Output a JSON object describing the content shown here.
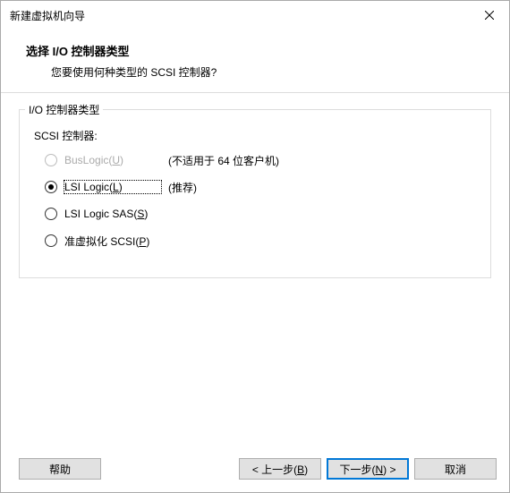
{
  "titlebar": {
    "title": "新建虚拟机向导"
  },
  "header": {
    "title": "选择 I/O 控制器类型",
    "subtitle": "您要使用何种类型的 SCSI 控制器?"
  },
  "group": {
    "legend": "I/O 控制器类型",
    "scsi_label": "SCSI 控制器:",
    "options": [
      {
        "label_pre": "BusLogic(",
        "mnemonic": "U",
        "label_post": ")",
        "note": "(不适用于 64 位客户机)",
        "disabled": true,
        "checked": false
      },
      {
        "label_pre": "LSI Logic(",
        "mnemonic": "L",
        "label_post": ")",
        "note": "(推荐)",
        "disabled": false,
        "checked": true,
        "focused": true
      },
      {
        "label_pre": "LSI Logic SAS(",
        "mnemonic": "S",
        "label_post": ")",
        "note": "",
        "disabled": false,
        "checked": false
      },
      {
        "label_pre": "准虚拟化 SCSI(",
        "mnemonic": "P",
        "label_post": ")",
        "note": "",
        "disabled": false,
        "checked": false
      }
    ]
  },
  "footer": {
    "help": "帮助",
    "back_pre": "< 上一步(",
    "back_mn": "B",
    "back_post": ")",
    "next_pre": "下一步(",
    "next_mn": "N",
    "next_post": ") >",
    "cancel": "取消"
  }
}
